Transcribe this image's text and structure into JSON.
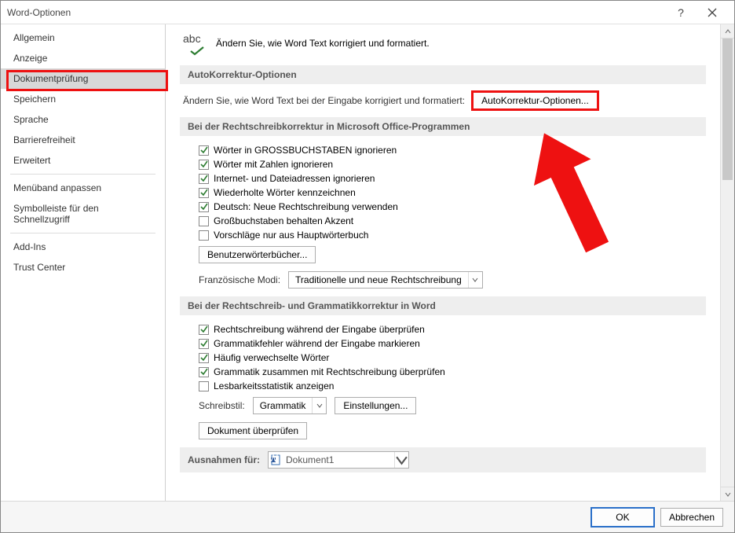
{
  "window_title": "Word-Optionen",
  "sidebar": {
    "items": [
      "Allgemein",
      "Anzeige",
      "Dokumentprüfung",
      "Speichern",
      "Sprache",
      "Barrierefreiheit",
      "Erweitert",
      "Menüband anpassen",
      "Symbolleiste für den Schnellzugriff",
      "Add-Ins",
      "Trust Center"
    ],
    "selected_index": 2,
    "separators_after_index": [
      6,
      8
    ]
  },
  "intro": {
    "abc": "abc",
    "text": "Ändern Sie, wie Word Text korrigiert und formatiert."
  },
  "section1": {
    "heading": "AutoKorrektur-Optionen",
    "label": "Ändern Sie, wie Word Text bei der Eingabe korrigiert und formatiert:",
    "button": "AutoKorrektur-Optionen..."
  },
  "section2": {
    "heading": "Bei der Rechtschreibkorrektur in Microsoft Office-Programmen",
    "checks": [
      {
        "label": "Wörter in GROSSBUCHSTABEN ignorieren",
        "checked": true
      },
      {
        "label": "Wörter mit Zahlen ignorieren",
        "checked": true
      },
      {
        "label": "Internet- und Dateiadressen ignorieren",
        "checked": true
      },
      {
        "label": "Wiederholte Wörter kennzeichnen",
        "checked": true
      },
      {
        "label": "Deutsch: Neue Rechtschreibung verwenden",
        "checked": true
      },
      {
        "label": "Großbuchstaben behalten Akzent",
        "checked": false
      },
      {
        "label": "Vorschläge nur aus Hauptwörterbuch",
        "checked": false
      }
    ],
    "dict_button": "Benutzerwörterbücher...",
    "fr_label": "Französische Modi:",
    "fr_value": "Traditionelle und neue Rechtschreibung"
  },
  "section3": {
    "heading": "Bei der Rechtschreib- und Grammatikkorrektur in Word",
    "checks": [
      {
        "label": "Rechtschreibung während der Eingabe überprüfen",
        "checked": true
      },
      {
        "label": "Grammatikfehler während der Eingabe markieren",
        "checked": true
      },
      {
        "label": "Häufig verwechselte Wörter",
        "checked": true
      },
      {
        "label": "Grammatik zusammen mit Rechtschreibung überprüfen",
        "checked": true
      },
      {
        "label": "Lesbarkeitsstatistik anzeigen",
        "checked": false
      }
    ],
    "style_label": "Schreibstil:",
    "style_value": "Grammatik",
    "settings_button": "Einstellungen...",
    "check_doc_button": "Dokument überprüfen"
  },
  "section4": {
    "heading": "Ausnahmen für:",
    "doc_value": "Dokument1"
  },
  "footer": {
    "ok": "OK",
    "cancel": "Abbrechen"
  }
}
